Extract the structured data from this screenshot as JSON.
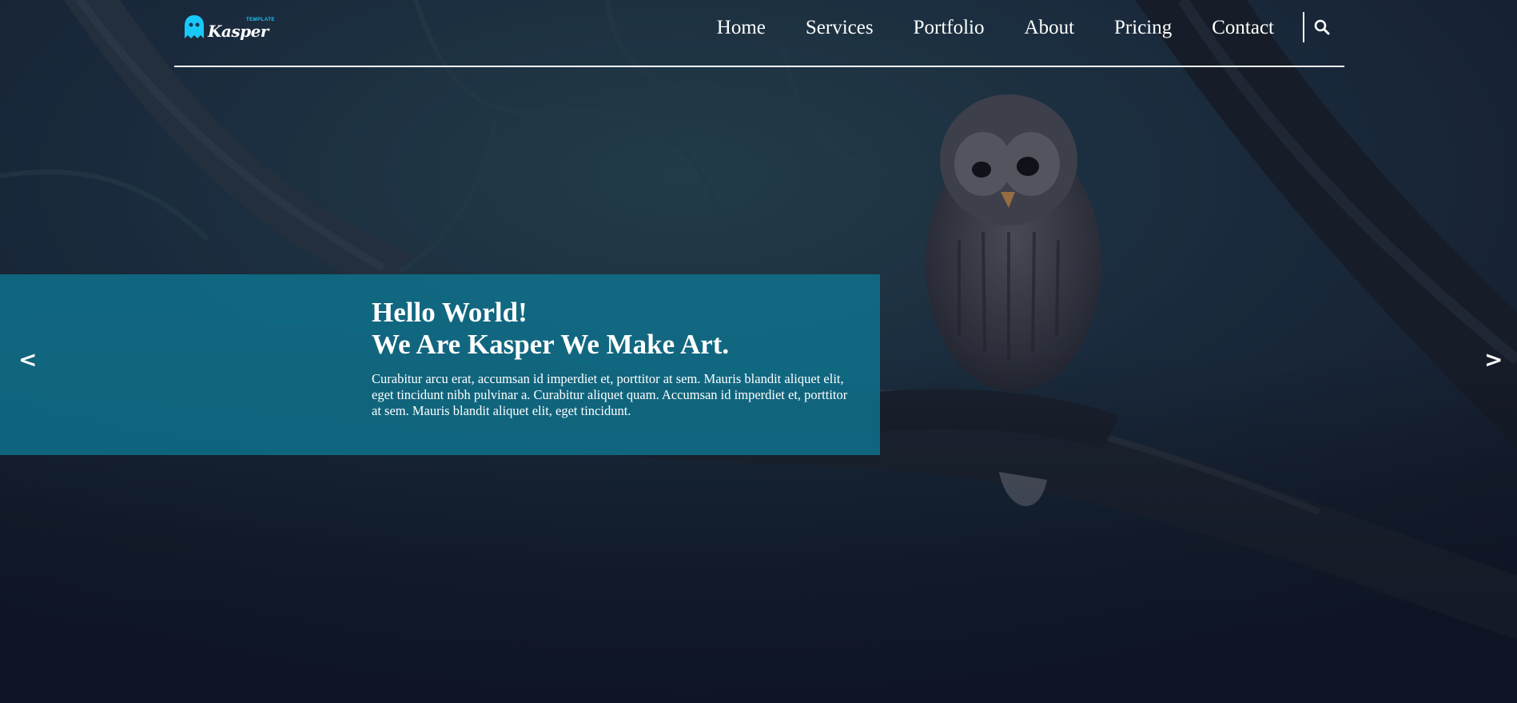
{
  "brand": {
    "name": "Kasper",
    "tag": "TEMPLATE",
    "accent_color": "#19c8fa"
  },
  "nav": {
    "items": [
      {
        "label": "Home"
      },
      {
        "label": "Services"
      },
      {
        "label": "Portfolio"
      },
      {
        "label": "About"
      },
      {
        "label": "Pricing"
      },
      {
        "label": "Contact"
      }
    ],
    "search_icon": "search-icon"
  },
  "hero": {
    "title_line1": "Hello World!",
    "title_line2": "We Are Kasper We Make Art.",
    "body": "Curabitur arcu erat, accumsan id imperdiet et, porttitor at sem. Mauris blandit aliquet elit, eget tincidunt nibh pulvinar a. Curabitur aliquet quam. Accumsan id imperdiet et, porttitor at sem. Mauris blandit aliquet elit, eget tincidunt.",
    "panel_color": "#0f748f"
  },
  "slider": {
    "prev_label": "<",
    "next_label": ">"
  }
}
